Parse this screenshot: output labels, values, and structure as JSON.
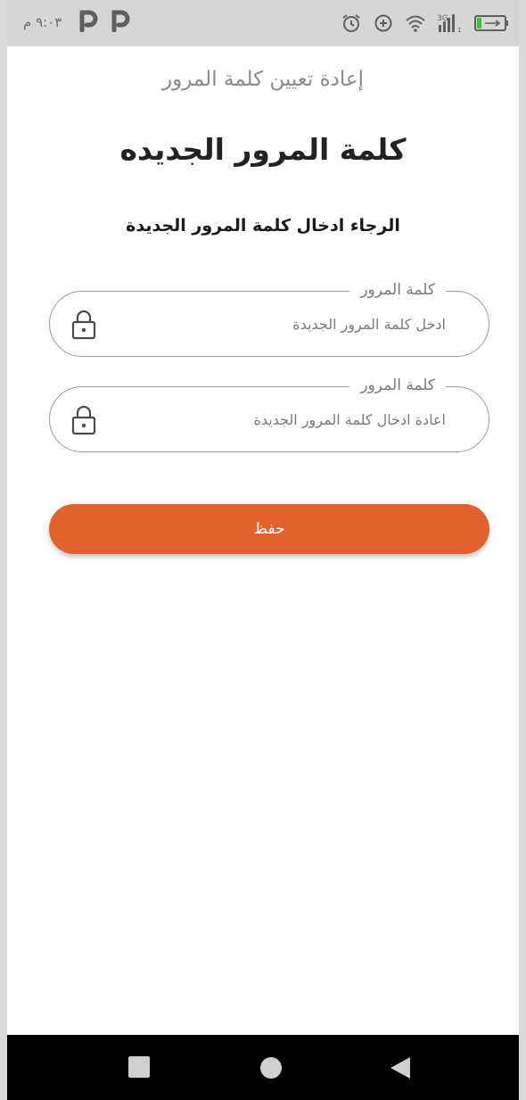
{
  "status_bar": {
    "time": "٩:٠٣ م",
    "notification_icons": [
      "parking-p-icon",
      "parking-p-icon"
    ],
    "system_icons": [
      "alarm-icon",
      "data-saver-icon",
      "wifi-icon",
      "signal-3g-icon",
      "battery-charging-icon"
    ],
    "network_label": "3G"
  },
  "header": {
    "title": "إعادة تعيين كلمة المرور"
  },
  "main": {
    "title": "كلمة المرور الجديده",
    "subtitle": "الرجاء ادخال كلمة المرور الجديدة"
  },
  "form": {
    "fields": [
      {
        "label": "كلمة المرور",
        "placeholder": "ادخل كلمة المرور الجديدة",
        "value": "",
        "icon": "lock-icon"
      },
      {
        "label": "كلمة المرور",
        "placeholder": "اعادة ادخال كلمة المرور الجديدة",
        "value": "",
        "icon": "lock-icon"
      }
    ],
    "save_label": "حفظ"
  },
  "nav_bar": {
    "buttons": [
      "recents-square-icon",
      "home-circle-icon",
      "back-triangle-icon"
    ]
  },
  "colors": {
    "accent": "#e0632d",
    "status_bar_bg": "#d6d6d6",
    "nav_bar_bg": "#000000",
    "field_border": "#9a9a9a"
  }
}
